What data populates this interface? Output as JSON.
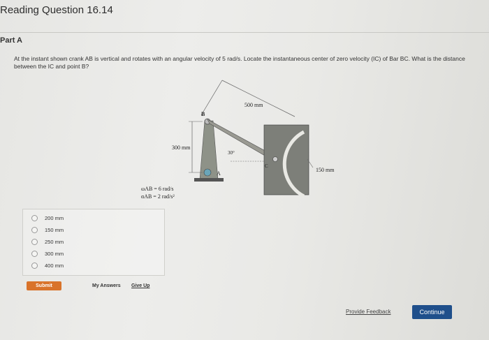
{
  "header": {
    "title": "Reading Question 16.14"
  },
  "part": {
    "label": "Part A"
  },
  "question": {
    "text": "At the instant shown crank AB is vertical and rotates with an angular velocity of 5 rad/s. Locate the instantaneous center of zero velocity (IC) of Bar BC. What is the distance between the IC and point B?"
  },
  "figure": {
    "label_500": "500 mm",
    "label_B": "B",
    "label_300": "300 mm",
    "label_30": "30°",
    "label_C": "C",
    "label_150": "150 mm",
    "label_A": "A",
    "omega": "ωAB = 6 rad/s",
    "alpha": "αAB = 2 rad/s²"
  },
  "choices": [
    {
      "label": "200 mm"
    },
    {
      "label": "150 mm"
    },
    {
      "label": "250 mm"
    },
    {
      "label": "300 mm"
    },
    {
      "label": "400 mm"
    }
  ],
  "actions": {
    "submit_label": "Submit",
    "my_answers_label": "My Answers",
    "give_up_label": "Give Up",
    "feedback_label": "Provide Feedback",
    "continue_label": "Continue"
  },
  "colors": {
    "submit": "#d9732a",
    "continue": "#1f4f8b"
  }
}
